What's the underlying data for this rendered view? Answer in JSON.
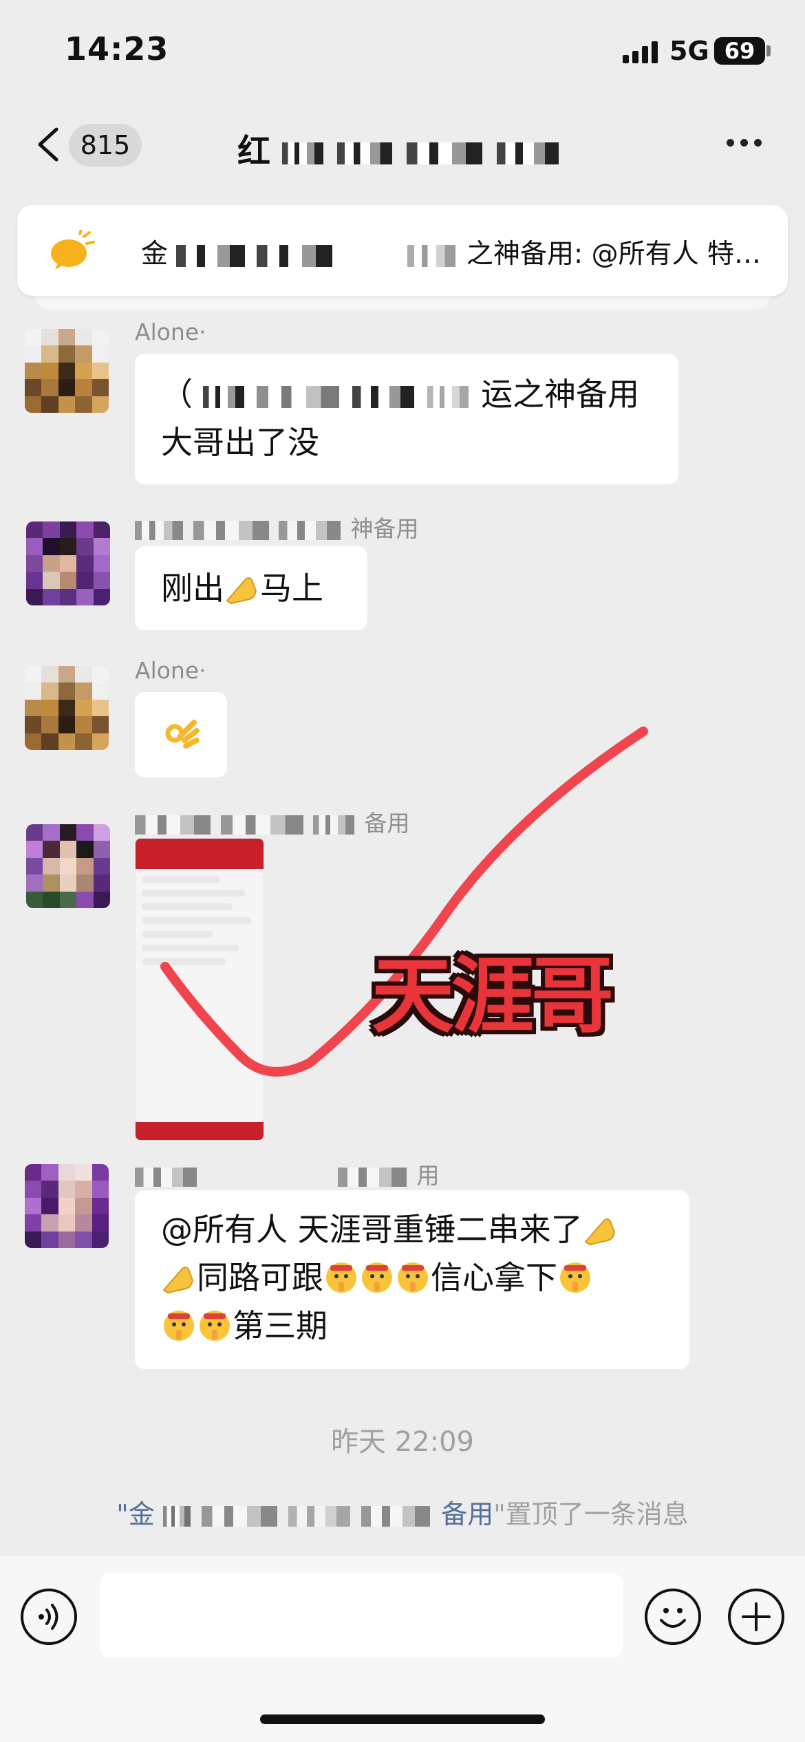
{
  "status_bar": {
    "time": "14:23",
    "network": "5G",
    "battery": "69"
  },
  "nav": {
    "back_count": "815",
    "title": "红"
  },
  "pinned": {
    "text_suffix": "之神备用: @所有人 特推单…",
    "text_prefix": "金"
  },
  "messages": [
    {
      "sender": "Alone·",
      "lines": [
        "（",
        "运之神备用",
        "大哥出了没"
      ]
    },
    {
      "sender": "神备用",
      "lines": [
        "刚出",
        "马上"
      ]
    },
    {
      "sender": "Alone·",
      "lines": []
    },
    {
      "sender": "备用",
      "image": true
    },
    {
      "sender": "用",
      "lines": [
        "@所有人 天涯哥重锤二串来了",
        "同路可跟",
        "信心拿下",
        "第三期"
      ]
    }
  ],
  "overlay_label": "天涯哥",
  "timestamp": "昨天 22:09",
  "system_message": {
    "prefix": "\"金",
    "name_suffix": "备用",
    "suffix": "\"置顶了一条消息"
  },
  "icons": {
    "back": "chevron-left-icon",
    "more": "more-dots-icon",
    "pin": "megaphone-icon",
    "voice": "voice-icon",
    "emoji": "emoji-icon",
    "plus": "plus-icon"
  },
  "colors": {
    "background": "#ededed",
    "bubble": "#ffffff",
    "check": "#f0454e",
    "stamp": "#e7353a"
  }
}
